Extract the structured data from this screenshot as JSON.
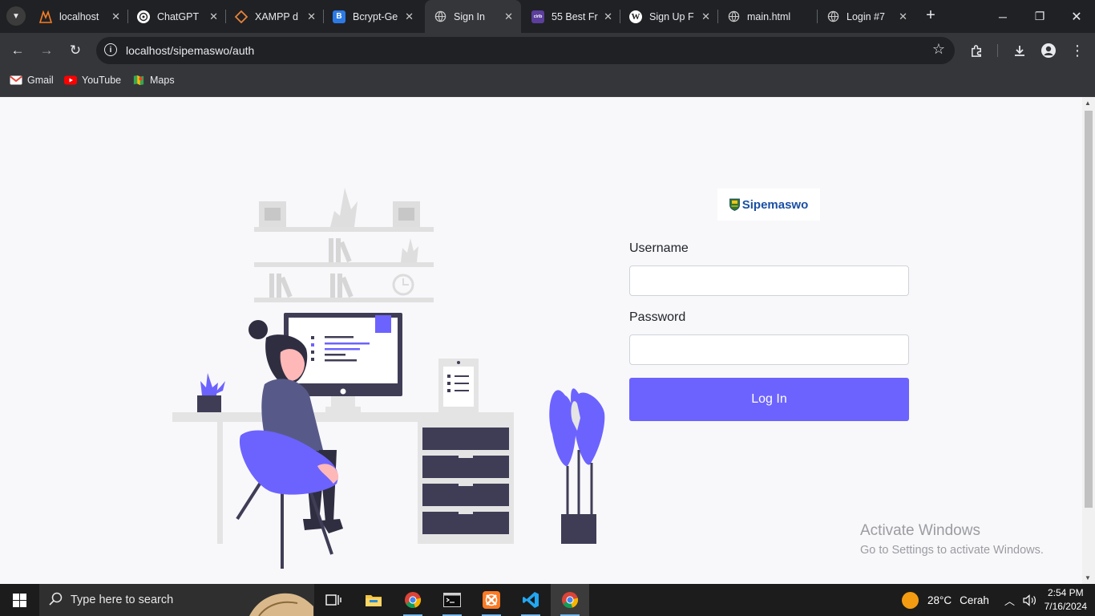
{
  "tabs": [
    {
      "title": "localhost",
      "icon": "xampp-icon",
      "active": false
    },
    {
      "title": "ChatGPT",
      "icon": "chatgpt-icon",
      "active": false
    },
    {
      "title": "XAMPP d",
      "icon": "xampp-diamond-icon",
      "active": false
    },
    {
      "title": "Bcrypt-Ge",
      "icon": "bcrypt-icon",
      "active": false
    },
    {
      "title": "Sign In",
      "icon": "globe-icon",
      "active": true
    },
    {
      "title": "55 Best Fr",
      "icon": "colorlib-icon",
      "active": false
    },
    {
      "title": "Sign Up F",
      "icon": "wordpress-icon",
      "active": false
    },
    {
      "title": "main.html",
      "icon": "globe-icon",
      "active": false
    },
    {
      "title": "Login #7",
      "icon": "globe-icon",
      "active": false
    }
  ],
  "address": {
    "url": "localhost/sipemaswo/auth"
  },
  "bookmarks": [
    {
      "label": "Gmail",
      "icon": "gmail-icon"
    },
    {
      "label": "YouTube",
      "icon": "youtube-icon"
    },
    {
      "label": "Maps",
      "icon": "maps-icon"
    }
  ],
  "page": {
    "logo_text": "Sipemaswo",
    "username_label": "Username",
    "username_value": "",
    "password_label": "Password",
    "password_value": "",
    "login_button": "Log In",
    "accent_color": "#6c63ff"
  },
  "watermark": {
    "title": "Activate Windows",
    "subtitle": "Go to Settings to activate Windows."
  },
  "taskbar": {
    "search_placeholder": "Type here to search",
    "apps": [
      "task-view",
      "file-explorer",
      "chrome",
      "terminal",
      "xampp-control",
      "vscode",
      "chrome"
    ],
    "weather_temp": "28°C",
    "weather_desc": "Cerah",
    "time": "2:54 PM",
    "date": "7/16/2024"
  }
}
